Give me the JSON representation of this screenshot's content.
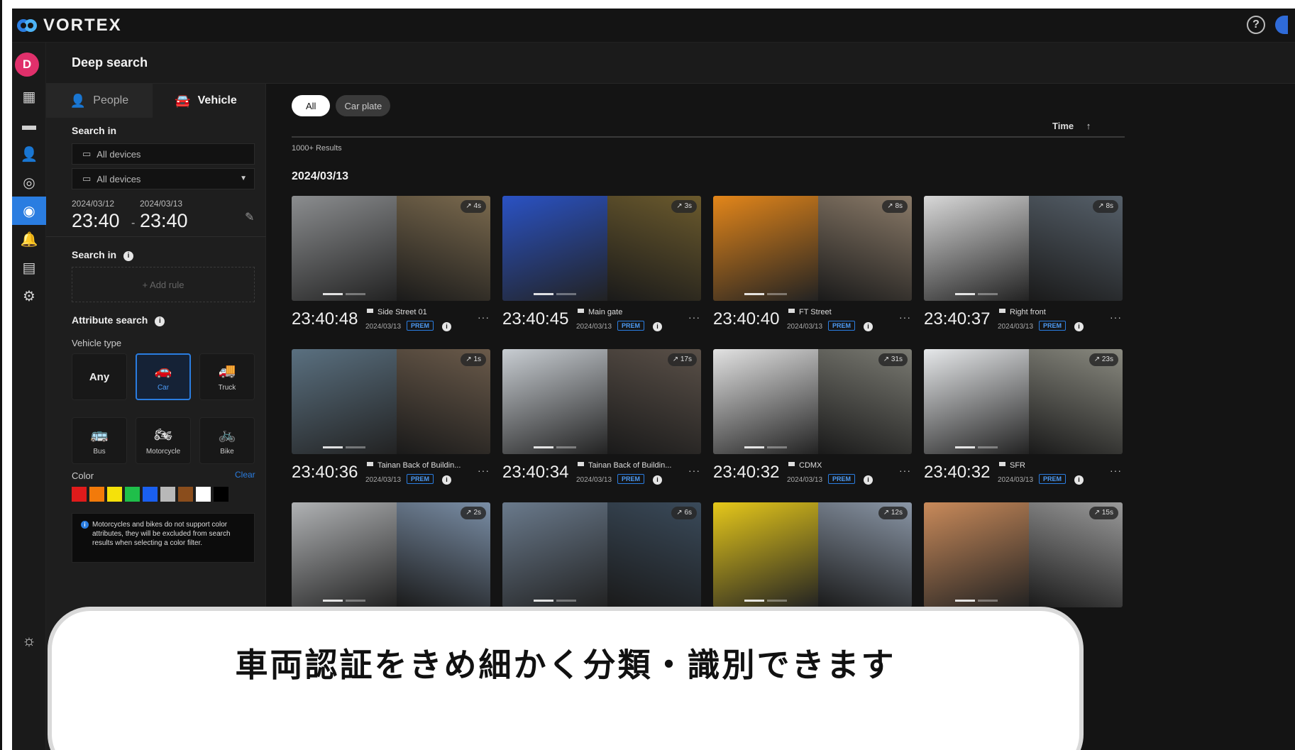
{
  "app": {
    "name": "VORTEX"
  },
  "header": {
    "title": "Deep search"
  },
  "user": {
    "initial": "D"
  },
  "rail": {
    "items": [
      {
        "name": "dashboard-icon",
        "glyph": "▦"
      },
      {
        "name": "video-icon",
        "glyph": "▬"
      },
      {
        "name": "person-icon",
        "glyph": "👤"
      },
      {
        "name": "layers-icon",
        "glyph": "◎"
      },
      {
        "name": "deep-search-icon",
        "glyph": "◉"
      },
      {
        "name": "bell-icon",
        "glyph": "🔔"
      },
      {
        "name": "archive-icon",
        "glyph": "▤"
      },
      {
        "name": "settings-icon",
        "glyph": "⚙"
      }
    ],
    "bottom_glyph": "☼"
  },
  "panel": {
    "tabs": {
      "people": "People",
      "vehicle": "Vehicle"
    },
    "search_in_label": "Search in",
    "device_field_1": "All devices",
    "device_field_2": "All devices",
    "start_date": "2024/03/12",
    "start_time": "23:40",
    "end_date": "2024/03/13",
    "end_time": "23:40",
    "search_in_rules_label": "Search in",
    "add_rule": "+ Add rule",
    "attribute_search_label": "Attribute search",
    "vehicle_type_label": "Vehicle type",
    "vehicle_types": {
      "any": "Any",
      "car": "Car",
      "truck": "Truck",
      "bus": "Bus",
      "motorcycle": "Motorcycle",
      "bike": "Bike"
    },
    "color_label": "Color",
    "clear_label": "Clear",
    "colors": [
      "#e01b1b",
      "#f27a0a",
      "#f5e10a",
      "#1fbf4a",
      "#1a5ff0",
      "#b8b8b8",
      "#8a4d1c",
      "#ffffff",
      "#000000"
    ],
    "notice": "Motorcycles and bikes do not support color attributes, they will be excluded from search results when selecting a color filter."
  },
  "main": {
    "filters": {
      "all": "All",
      "car_plate": "Car plate"
    },
    "sort_label": "Time",
    "sort_arrow": "↑",
    "results_count": "1000+ Results",
    "date_group": "2024/03/13",
    "cards": [
      {
        "time": "23:40:48",
        "camera": "Side Street 01",
        "date": "2024/03/13",
        "badge": "PREM",
        "duration": "4s",
        "left_color": "#8b8d8f",
        "right_color": "#7b6a4e"
      },
      {
        "time": "23:40:45",
        "camera": "Main gate",
        "date": "2024/03/13",
        "badge": "PREM",
        "duration": "3s",
        "left_color": "#2a52c4",
        "right_color": "#6b5a2d"
      },
      {
        "time": "23:40:40",
        "camera": "FT Street",
        "date": "2024/03/13",
        "badge": "PREM",
        "duration": "8s",
        "left_color": "#e3861a",
        "right_color": "#8a7a68"
      },
      {
        "time": "23:40:37",
        "camera": "Right front",
        "date": "2024/03/13",
        "badge": "PREM",
        "duration": "8s",
        "left_color": "#d8d8d8",
        "right_color": "#56606a"
      },
      {
        "time": "23:40:36",
        "camera": "Tainan Back of Buildin...",
        "date": "2024/03/13",
        "badge": "PREM",
        "duration": "1s",
        "left_color": "#5a7080",
        "right_color": "#6a5a4a"
      },
      {
        "time": "23:40:34",
        "camera": "Tainan Back of Buildin...",
        "date": "2024/03/13",
        "badge": "PREM",
        "duration": "17s",
        "left_color": "#c8cdd2",
        "right_color": "#5a5048"
      },
      {
        "time": "23:40:32",
        "camera": "CDMX",
        "date": "2024/03/13",
        "badge": "PREM",
        "duration": "31s",
        "left_color": "#e2e2e2",
        "right_color": "#7a7a72"
      },
      {
        "time": "23:40:32",
        "camera": "SFR",
        "date": "2024/03/13",
        "badge": "PREM",
        "duration": "23s",
        "left_color": "#e6e8ea",
        "right_color": "#8a8a80"
      },
      {
        "time": "",
        "camera": "",
        "date": "",
        "badge": "",
        "duration": "2s",
        "left_color": "#b0b2b4",
        "right_color": "#7a8ea6"
      },
      {
        "time": "",
        "camera": "",
        "date": "",
        "badge": "",
        "duration": "6s",
        "left_color": "#6a7a8c",
        "right_color": "#3a4a5a"
      },
      {
        "time": "",
        "camera": "",
        "date": "",
        "badge": "",
        "duration": "12s",
        "left_color": "#e6c81a",
        "right_color": "#8a96a6"
      },
      {
        "time": "",
        "camera": "",
        "date": "",
        "badge": "",
        "duration": "15s",
        "left_color": "#c98a5a",
        "right_color": "#9a9a9a"
      }
    ]
  },
  "overlay": {
    "caption": "車両認証をきめ細かく分類・識別できます"
  }
}
